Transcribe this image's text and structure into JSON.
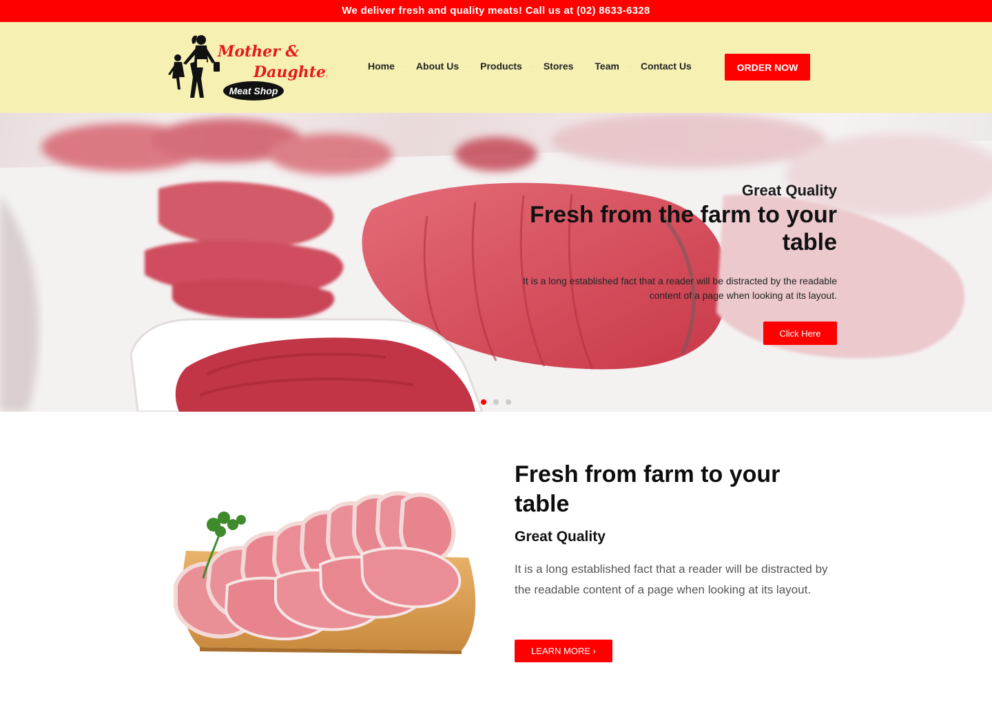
{
  "topbar": {
    "text": "We deliver fresh and quality meats! Call us at (02) 8633-6328"
  },
  "logo": {
    "line1": "Mother &",
    "line2": "Daughter",
    "badge": "Meat Shop"
  },
  "nav": {
    "items": [
      "Home",
      "About Us",
      "Products",
      "Stores",
      "Team",
      "Contact Us"
    ],
    "order_label": "ORDER NOW"
  },
  "hero": {
    "subtitle": "Great Quality",
    "title": "Fresh from the farm to your table",
    "text": "It is a long established fact that a reader will be distracted by the readable content of a page when looking at its layout.",
    "button": "Click Here",
    "slides": 3,
    "active_slide": 1
  },
  "feature": {
    "title": "Fresh from farm to your table",
    "subtitle": "Great Quality",
    "text": "It is a long established fact that a reader will be distracted by the readable content of a page when looking at its layout.",
    "button": "LEARN MORE ›"
  },
  "colors": {
    "accent": "#ff0000",
    "header_bg": "#f6f0b3"
  }
}
